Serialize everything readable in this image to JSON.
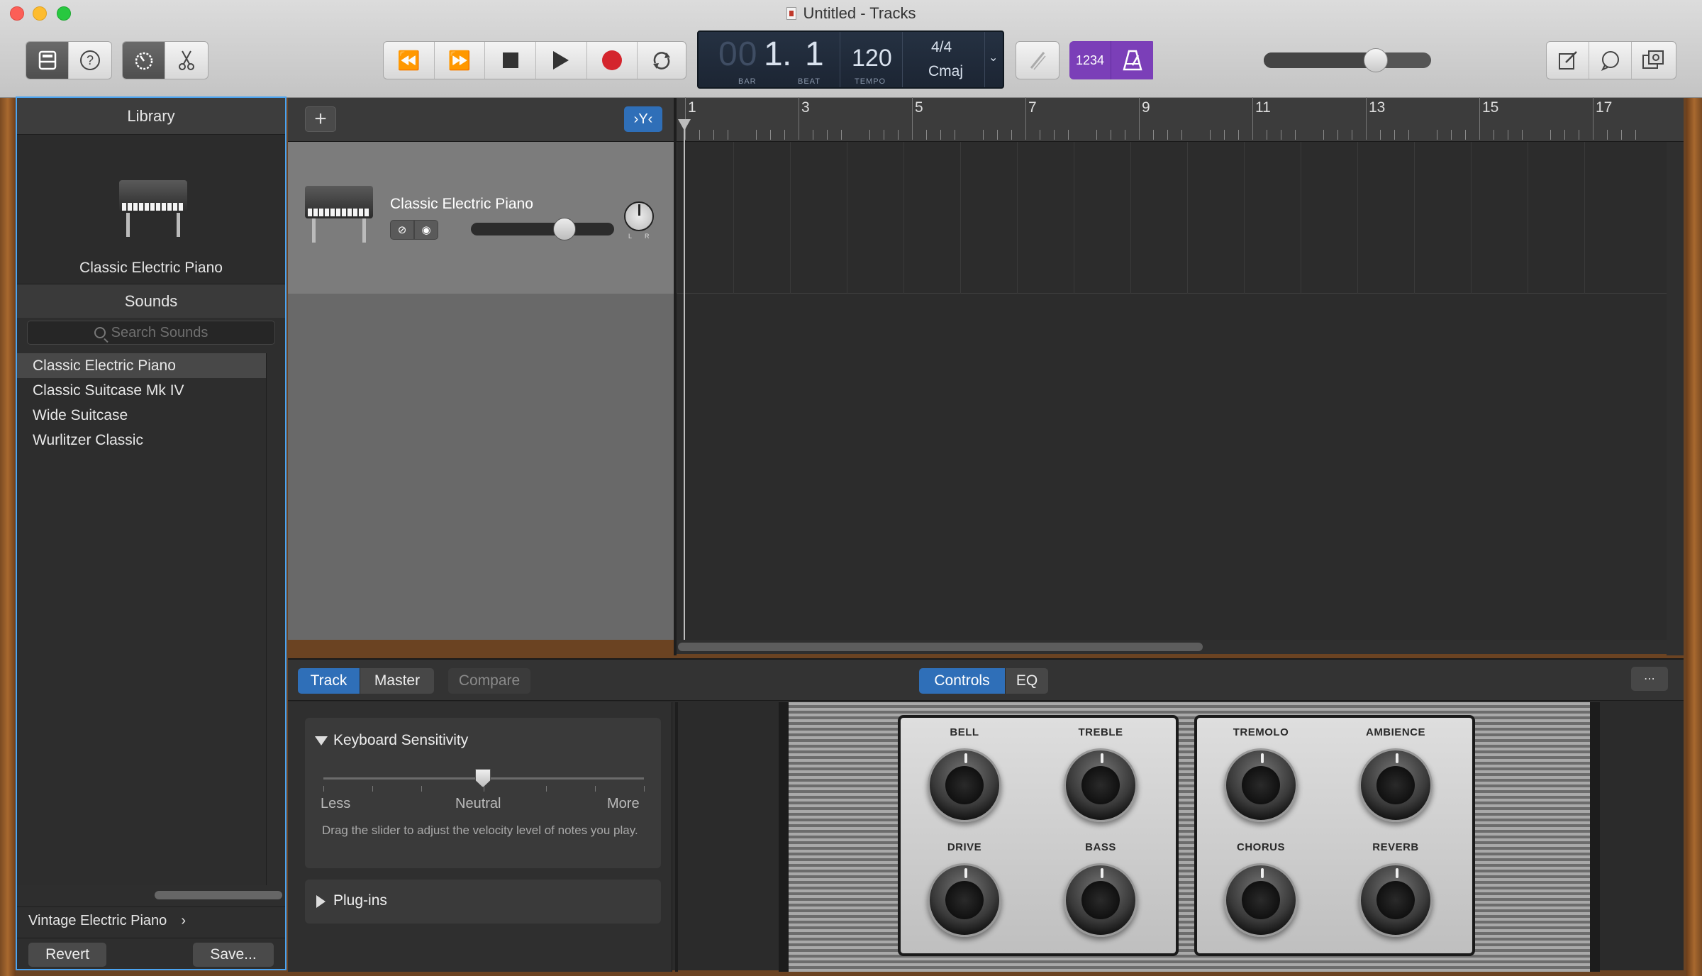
{
  "window": {
    "title": "Untitled - Tracks"
  },
  "toolbar": {
    "library_icon": "library-icon",
    "help_icon": "question-icon",
    "smart_controls_icon": "dial-icon",
    "editors_icon": "scissors-icon",
    "rewind_icon": "rewind-icon",
    "forward_icon": "fast-forward-icon",
    "stop_icon": "stop-icon",
    "play_icon": "play-icon",
    "record_icon": "record-icon",
    "cycle_icon": "cycle-icon",
    "lcd": {
      "bar_dim": "00",
      "bar": "1",
      "beat": "1",
      "bar_caption": "BAR",
      "beat_caption": "BEAT",
      "tempo": "120",
      "tempo_caption": "TEMPO",
      "time_signature": "4/4",
      "key": "Cmaj"
    },
    "count_in_label": "1234",
    "metronome_icon": "metronome-icon",
    "tuner_icon": "tuner-icon",
    "master_volume": 0.7,
    "note_pad_icon": "notepad-icon",
    "loop_browser_icon": "loop-icon",
    "media_browser_icon": "media-icon"
  },
  "library": {
    "header": "Library",
    "instrument_name": "Classic Electric Piano",
    "sounds_header": "Sounds",
    "search_placeholder": "Search Sounds",
    "sounds": [
      {
        "label": "Classic Electric Piano",
        "selected": true
      },
      {
        "label": "Classic Suitcase Mk IV",
        "selected": false
      },
      {
        "label": "Wide Suitcase",
        "selected": false
      },
      {
        "label": "Wurlitzer Classic",
        "selected": false
      }
    ],
    "category": "Vintage Electric Piano",
    "category_arrow": "›",
    "revert_label": "Revert",
    "save_label": "Save..."
  },
  "tracks": {
    "add_label": "+",
    "filter_label": "›Y‹",
    "track": {
      "name": "Classic Electric Piano",
      "volume": 0.68,
      "pan_l": "L",
      "pan_r": "R"
    },
    "ruler_bars": [
      "1",
      "3",
      "5",
      "7",
      "9",
      "11",
      "13",
      "15",
      "17"
    ]
  },
  "smart_controls": {
    "tabs": [
      {
        "label": "Track",
        "active": true
      },
      {
        "label": "Master",
        "active": false
      },
      {
        "label": "Compare",
        "active": false
      }
    ],
    "view_tabs": [
      {
        "label": "Controls",
        "active": true
      },
      {
        "label": "EQ",
        "active": false
      }
    ],
    "keyboard_sensitivity": {
      "title": "Keyboard Sensitivity",
      "less": "Less",
      "neutral": "Neutral",
      "more": "More",
      "description": "Drag the slider to adjust the velocity level of notes you play.",
      "value": 0.5
    },
    "plugins_title": "Plug-ins",
    "knobs": [
      {
        "label": "BELL"
      },
      {
        "label": "TREBLE"
      },
      {
        "label": "TREMOLO"
      },
      {
        "label": "AMBIENCE"
      },
      {
        "label": "DRIVE"
      },
      {
        "label": "BASS"
      },
      {
        "label": "CHORUS"
      },
      {
        "label": "REVERB"
      }
    ]
  },
  "colors": {
    "accent": "#2f6fb8",
    "purple": "#7b3fb8",
    "record": "#d4252d",
    "library_border": "#4aa3f0"
  }
}
